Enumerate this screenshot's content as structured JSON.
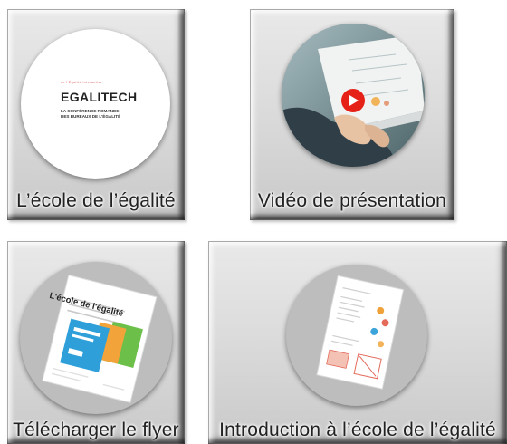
{
  "cards": [
    {
      "caption": "L’école de l’égalité",
      "thumbnail": {
        "tag": "de l'Égalité Interactive",
        "title": "EGALITECH",
        "subtitle_1": "LA CONFÉRENCE ROMANDE",
        "subtitle_2": "DES BUREAUX DE L'ÉGALITÉ"
      }
    },
    {
      "caption": "Vidéo de présentation",
      "play_icon": "play-icon"
    },
    {
      "caption": "Télécharger le flyer",
      "flyer_title": "L'école de l'égalité"
    },
    {
      "caption": "Introduction à l’école de l’égalité"
    }
  ],
  "colors": {
    "card_bg": "#dcdcdc",
    "circle_grey": "#bdbdbd",
    "play_red": "#e62117",
    "accent_red": "#e15a5a"
  }
}
